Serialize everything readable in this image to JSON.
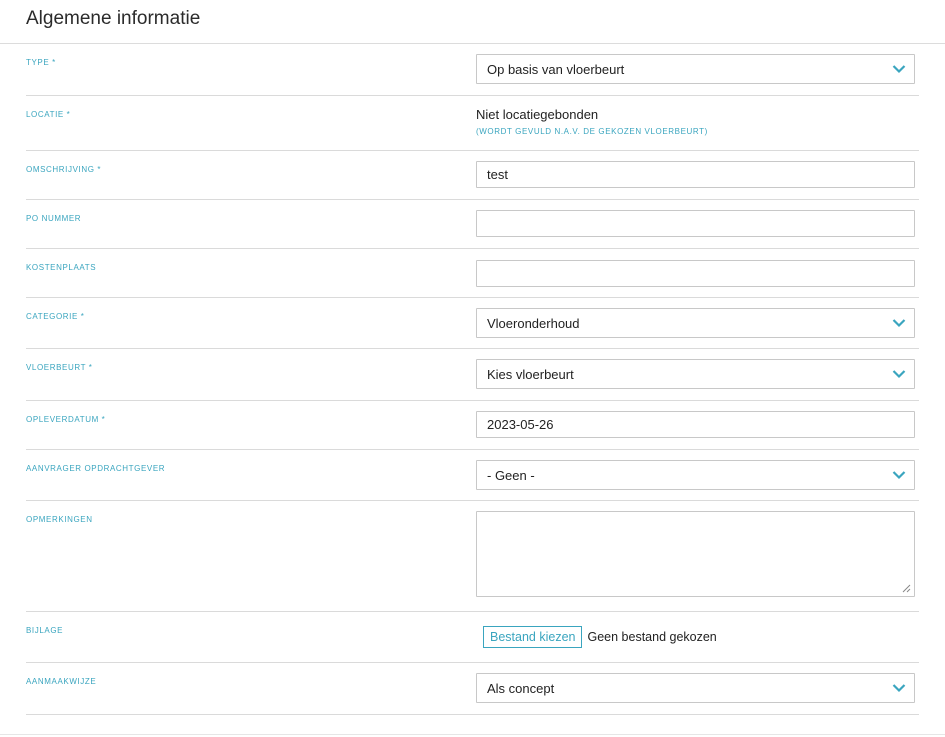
{
  "header": {
    "title": "Algemene informatie"
  },
  "fields": {
    "type": {
      "label": "TYPE *",
      "value": "Op basis van vloerbeurt",
      "icon": "chevron-down-icon"
    },
    "locatie": {
      "label": "LOCATIE *",
      "value": "Niet locatiegebonden",
      "hint": "(WORDT GEVULD N.A.V. DE GEKOZEN VLOERBEURT)"
    },
    "omschrijving": {
      "label": "OMSCHRIJVING *",
      "value": "test"
    },
    "po_nummer": {
      "label": "PO NUMMER",
      "value": ""
    },
    "kostenplaats": {
      "label": "KOSTENPLAATS",
      "value": ""
    },
    "categorie": {
      "label": "CATEGORIE *",
      "value": "Vloeronderhoud",
      "icon": "chevron-down-icon"
    },
    "vloerbeurt": {
      "label": "VLOERBEURT *",
      "value": "Kies vloerbeurt",
      "icon": "chevron-down-icon"
    },
    "opleverdatum": {
      "label": "OPLEVERDATUM *",
      "value": "2023-05-26"
    },
    "aanvrager": {
      "label": "AANVRAGER OPDRACHTGEVER",
      "value": "- Geen -",
      "icon": "chevron-down-icon"
    },
    "opmerkingen": {
      "label": "OPMERKINGEN",
      "value": ""
    },
    "bijlage": {
      "label": "BIJLAGE",
      "button": "Bestand kiezen",
      "status": "Geen bestand gekozen"
    },
    "aanmaakwijze": {
      "label": "AANMAAKWIJZE",
      "value": "Als concept",
      "icon": "chevron-down-icon"
    }
  },
  "colors": {
    "accent": "#3aa5bf",
    "border": "#c8c8c8",
    "divider": "#dadada"
  }
}
